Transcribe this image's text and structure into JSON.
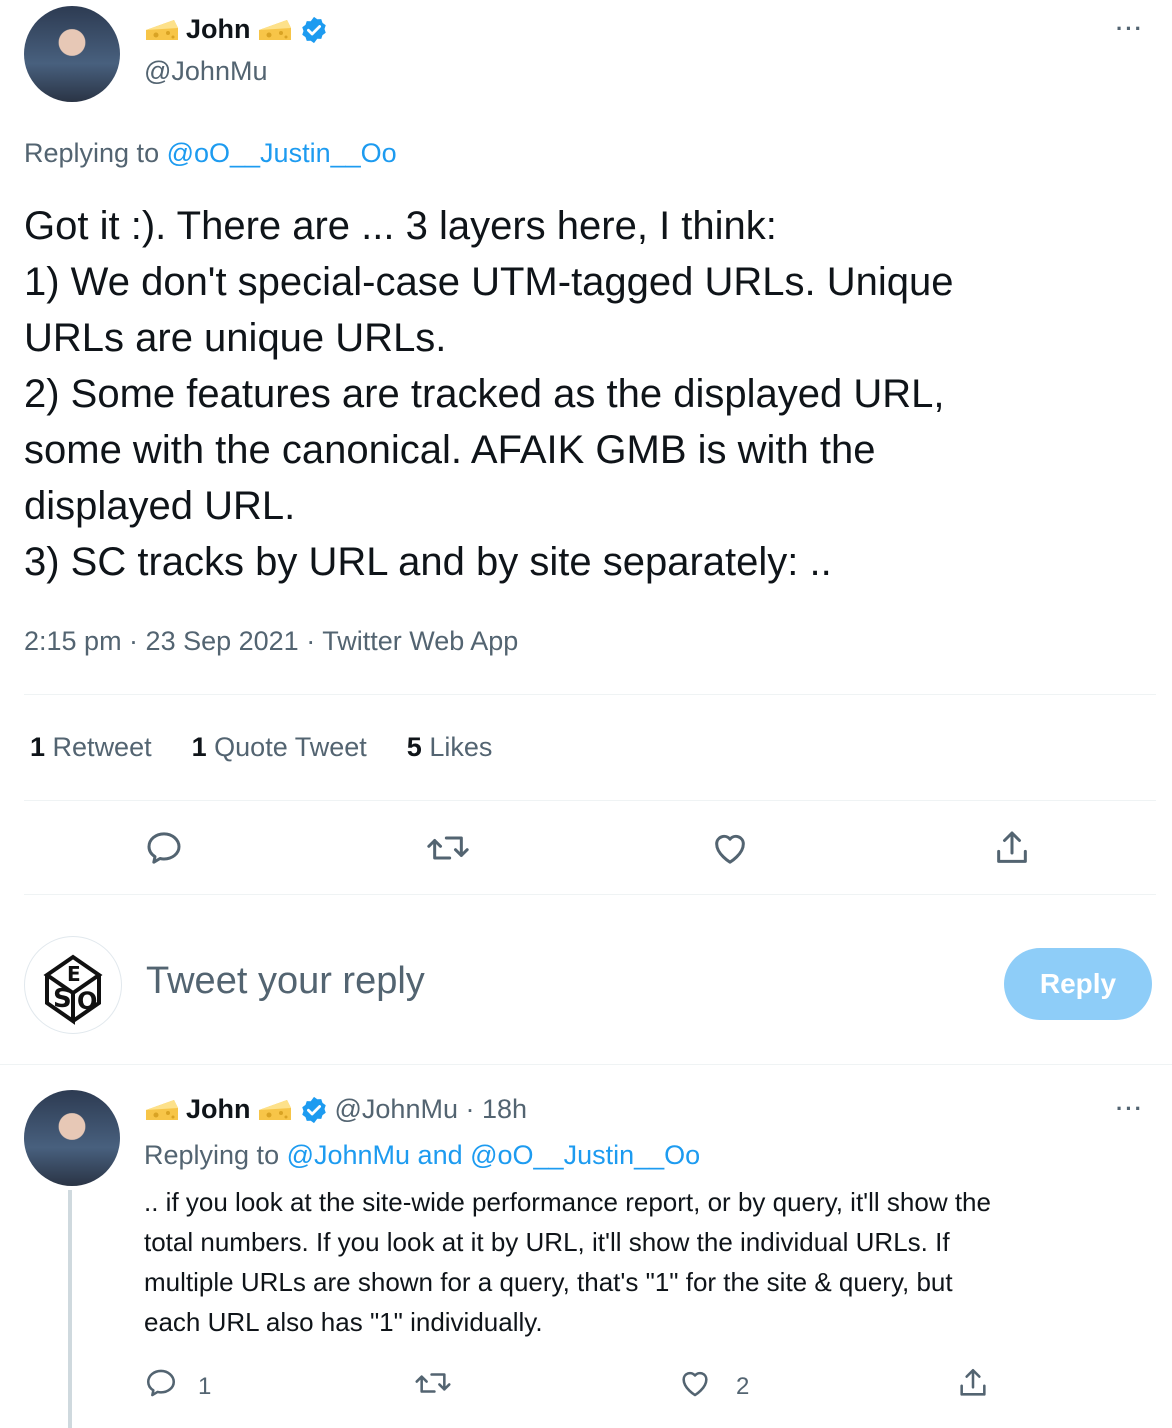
{
  "main_tweet": {
    "author_name": "John",
    "handle": "@JohnMu",
    "more_label": "···",
    "replying_prefix": "Replying to ",
    "replying_to": "@oO__Justin__Oo",
    "text_lines": [
      "Got it :). There are ... 3 layers here, I think:",
      "1) We don't special-case UTM-tagged URLs. Unique",
      "URLs are unique URLs.",
      "2) Some features are tracked as the displayed URL,",
      "some with the canonical. AFAIK GMB is with the",
      "displayed URL.",
      "3) SC tracks by URL and by site separately: .."
    ],
    "meta": "2:15 pm · 23 Sep 2021 · Twitter Web App",
    "stats": {
      "retweets_count": "1",
      "retweets_label": "Retweet",
      "quotes_count": "1",
      "quotes_label": "Quote Tweet",
      "likes_count": "5",
      "likes_label": "Likes"
    },
    "icons": [
      "reply-icon",
      "retweet-icon",
      "like-icon",
      "share-icon"
    ]
  },
  "composer": {
    "placeholder": "Tweet your reply",
    "reply_button": "Reply"
  },
  "reply_tweet": {
    "author_name": "John",
    "handle_time": "@JohnMu · 18h",
    "more_label": "···",
    "replying_prefix": "Replying to ",
    "replying_to": "@JohnMu and @oO__Justin__Oo",
    "text_lines": [
      ".. if you look at the site-wide performance report, or by query, it'll show the",
      "total numbers. If you look at it by URL, it'll show the individual URLs. If",
      "multiple URLs are shown for a query, that's \"1\" for the site & query, but",
      "each URL also has \"1\" individually."
    ],
    "reply_count": "1",
    "like_count": "2"
  },
  "colors": {
    "accent": "#1d9bf0",
    "muted": "#536471",
    "reply_button_disabled": "#8ecdf8"
  }
}
